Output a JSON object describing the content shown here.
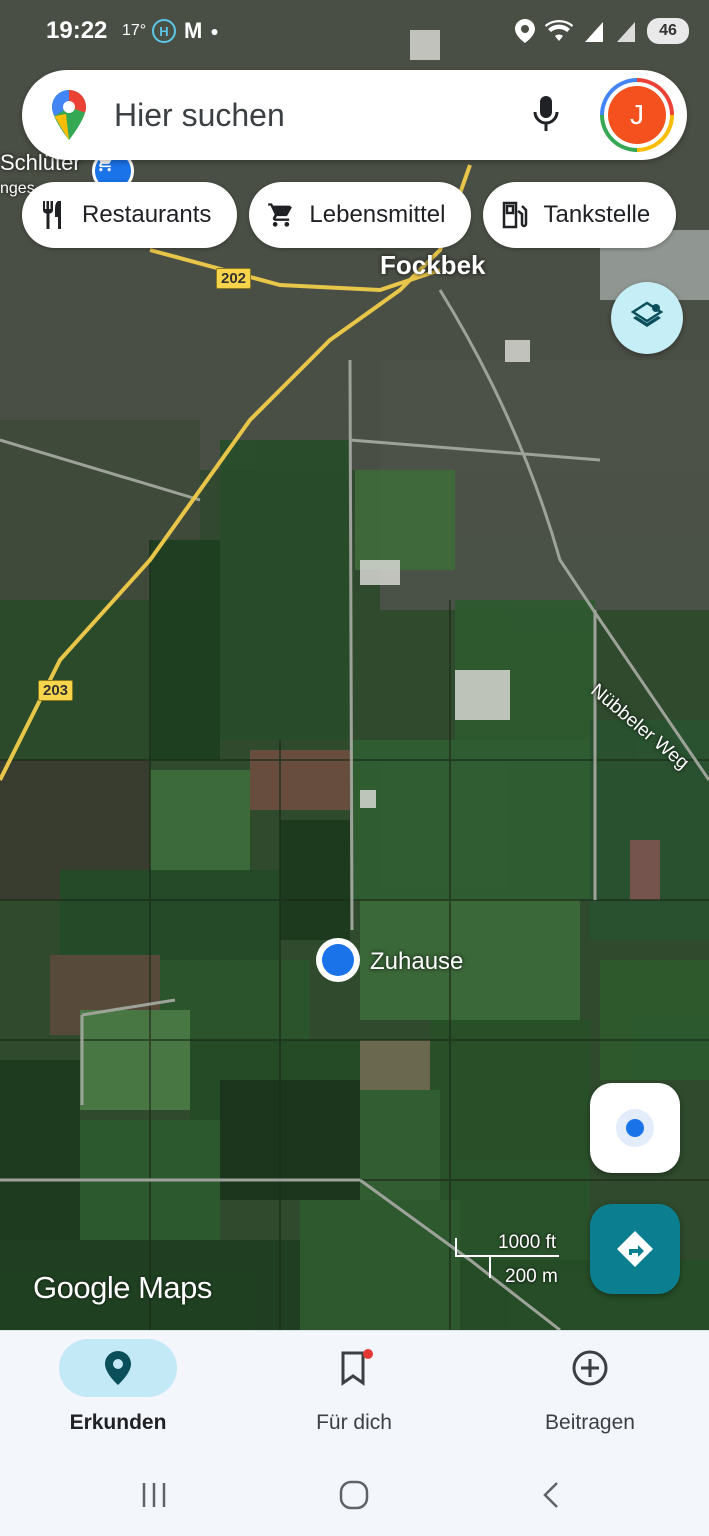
{
  "status_bar": {
    "time": "19:22",
    "temperature": "17°",
    "battery": "46"
  },
  "search": {
    "placeholder": "Hier suchen",
    "avatar_initial": "J"
  },
  "chips": [
    {
      "label": "Restaurants",
      "icon": "fork-knife-icon"
    },
    {
      "label": "Lebensmittel",
      "icon": "shopping-cart-icon"
    },
    {
      "label": "Tankstelle",
      "icon": "gas-station-icon"
    }
  ],
  "map": {
    "town_label": "Fockbek",
    "poi_label": "Schlüter",
    "poi_label_2": "nges",
    "street_label": "Nübbeler Weg",
    "road_202": "202",
    "road_203": "203",
    "home_label": "Zuhause",
    "scale_ft": "1000 ft",
    "scale_m": "200 m",
    "watermark": "Google Maps"
  },
  "bottom_nav": [
    {
      "label": "Erkunden",
      "icon": "explore-pin-icon",
      "active": true
    },
    {
      "label": "Für dich",
      "icon": "bookmark-icon",
      "active": false
    },
    {
      "label": "Beitragen",
      "icon": "add-circle-icon",
      "active": false
    }
  ],
  "colors": {
    "accent": "#0b7f90",
    "active_pill": "#c3e9f6",
    "avatar": "#f4511e",
    "road": "#f7d449"
  }
}
